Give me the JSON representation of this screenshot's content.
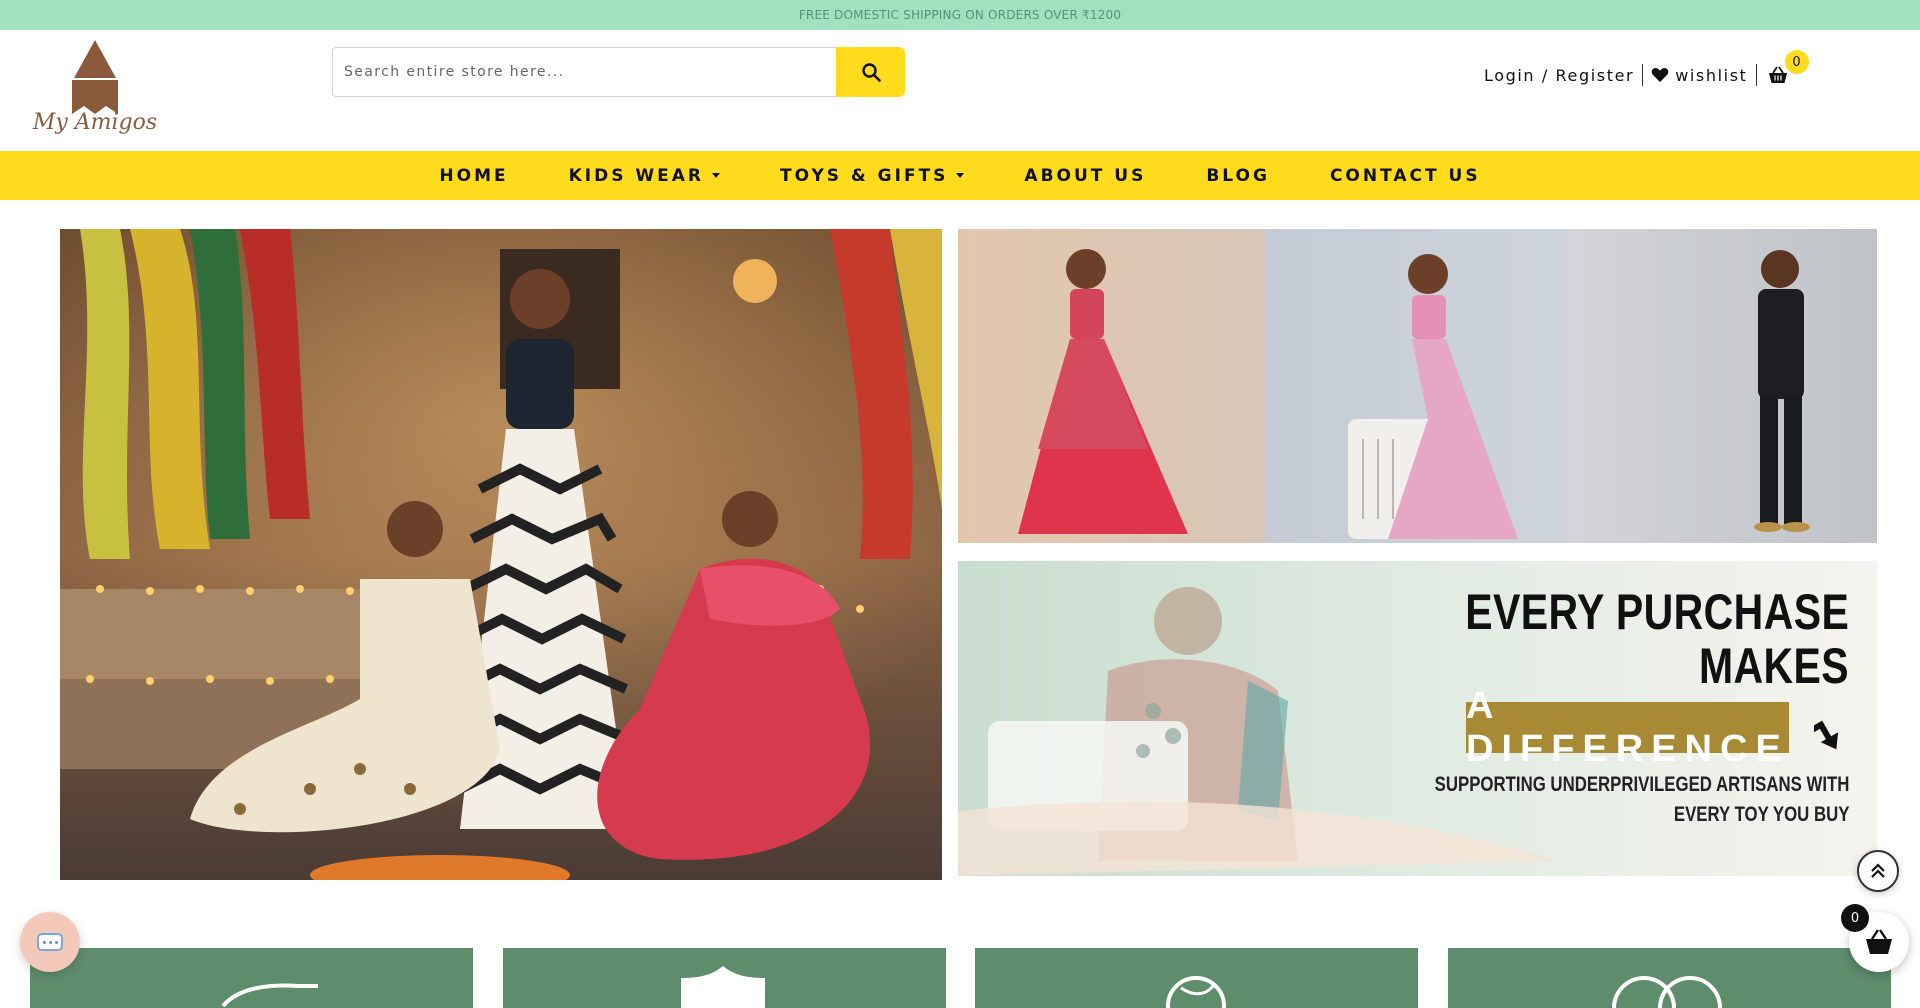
{
  "topbar": {
    "text": "FREE DOMESTIC SHIPPING ON ORDERS OVER ₹1200"
  },
  "logo": {
    "text": "My Amigos"
  },
  "search": {
    "placeholder": "Search entire store here...",
    "button_icon": "search-icon"
  },
  "account": {
    "login_label": "Login / Register",
    "wishlist_label": "wishlist",
    "cart_count": "0"
  },
  "nav": {
    "items": [
      {
        "label": "HOME",
        "has_dropdown": false
      },
      {
        "label": "KIDS WEAR",
        "has_dropdown": true
      },
      {
        "label": "TOYS & GIFTS",
        "has_dropdown": true
      },
      {
        "label": "ABOUT US",
        "has_dropdown": false
      },
      {
        "label": "BLOG",
        "has_dropdown": false
      },
      {
        "label": "CONTACT US",
        "has_dropdown": false
      }
    ]
  },
  "promo": {
    "line1": "EVERY PURCHASE",
    "line2": "MAKES",
    "highlight": "A DIFFERENCE",
    "sub1": "SUPPORTING UNDERPRIVILEGED ARTISANS WITH",
    "sub2": "EVERY TOY YOU BUY"
  },
  "floating": {
    "cart_count": "0"
  },
  "colors": {
    "topbar_bg": "#a3e0bd",
    "accent_yellow": "#fedb1c",
    "card_green": "#5e8d6c",
    "brand_brown": "#8b5a3c",
    "promo_gold": "#a98a34"
  }
}
